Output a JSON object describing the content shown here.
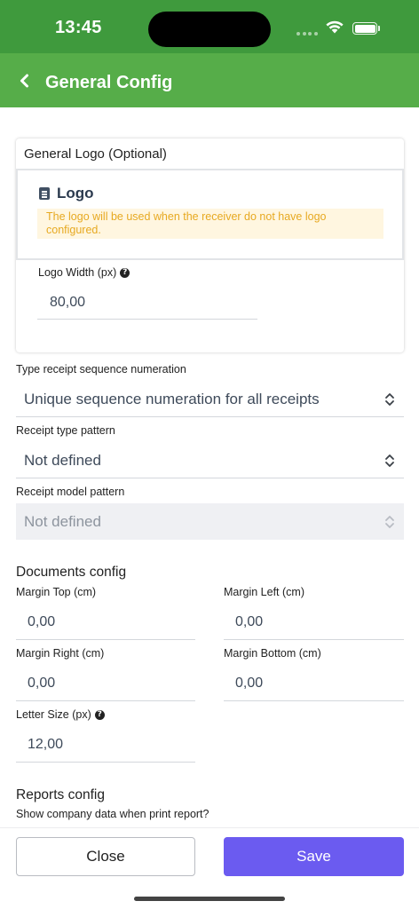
{
  "status": {
    "time": "13:45"
  },
  "header": {
    "title": "General Config"
  },
  "logo_card": {
    "title": "General Logo (Optional)",
    "logo_heading": "Logo",
    "warning": "The logo will be used when the receiver do not have logo configured.",
    "width_label": "Logo Width (px)",
    "width_value": "80,00"
  },
  "receipt": {
    "sequence_label": "Type receipt sequence numeration",
    "sequence_value": "Unique sequence numeration for all receipts",
    "type_pattern_label": "Receipt type pattern",
    "type_pattern_value": "Not defined",
    "model_pattern_label": "Receipt model pattern",
    "model_pattern_value": "Not defined"
  },
  "documents": {
    "title": "Documents config",
    "margin_top_label": "Margin Top (cm)",
    "margin_top_value": "0,00",
    "margin_left_label": "Margin Left (cm)",
    "margin_left_value": "0,00",
    "margin_right_label": "Margin Right (cm)",
    "margin_right_value": "0,00",
    "margin_bottom_label": "Margin Bottom (cm)",
    "margin_bottom_value": "0,00",
    "letter_size_label": "Letter Size (px)",
    "letter_size_value": "12,00"
  },
  "reports": {
    "title": "Reports config",
    "show_company_label": "Show company data when print report?"
  },
  "actions": {
    "close_label": "Close",
    "save_label": "Save"
  },
  "colors": {
    "status_bar": "#3f9a3d",
    "header": "#56ad49",
    "save_button": "#6b5bf0",
    "warning_text": "#e7a921",
    "warning_bg": "#fff6e0"
  }
}
